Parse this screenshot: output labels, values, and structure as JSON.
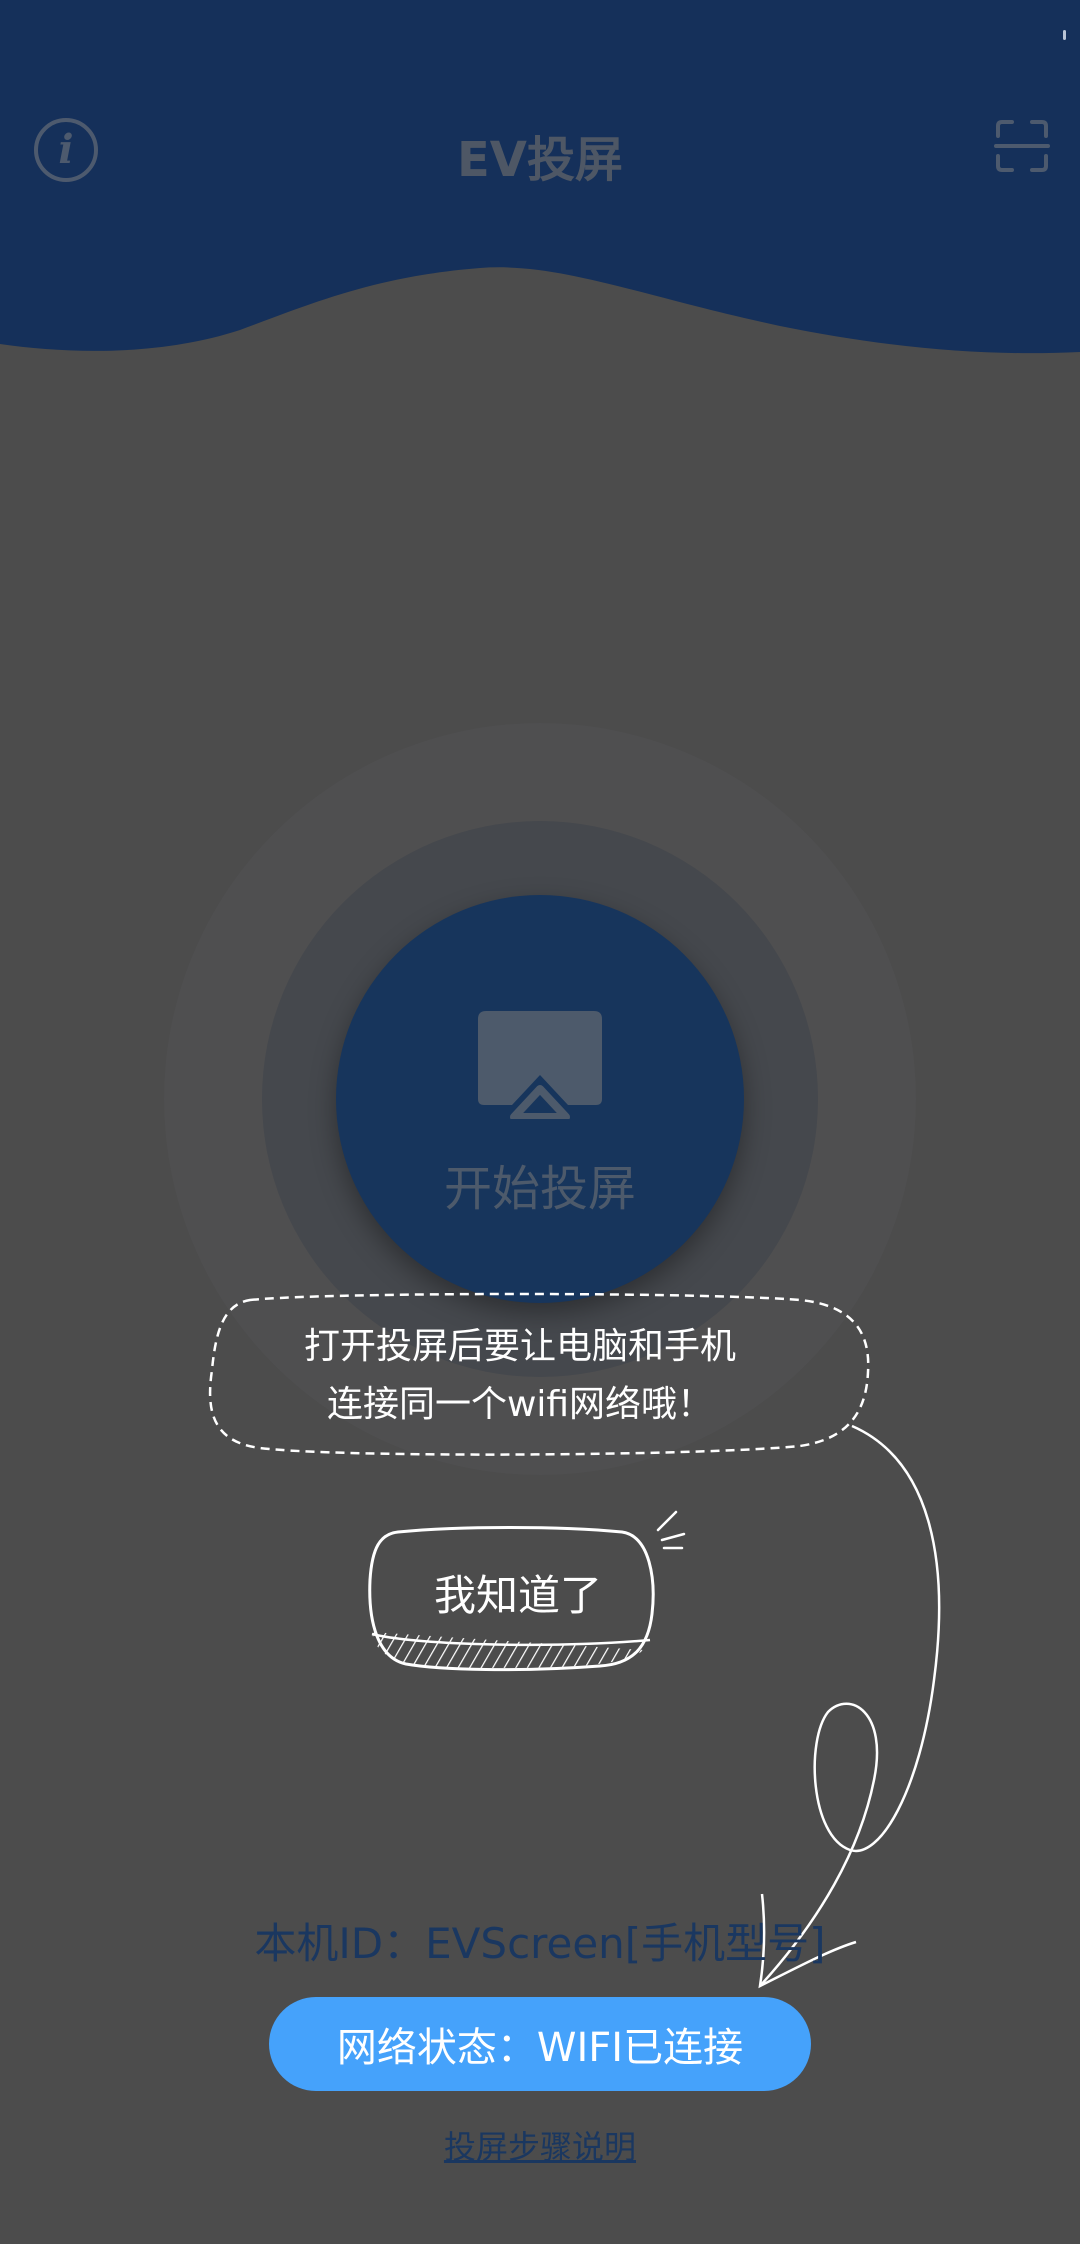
{
  "header": {
    "title": "EV投屏",
    "info_icon": "info-icon",
    "info_glyph": "i",
    "scan_icon": "scan-icon",
    "bg_color": "#15305a"
  },
  "main": {
    "start_label": "开始投屏",
    "start_icon": "screen-cast-icon",
    "button_color": "#17355c"
  },
  "tip": {
    "line1": "打开投屏后要让电脑和手机",
    "line2": "连接同一个wifi网络哦！",
    "confirm_label": "我知道了"
  },
  "footer": {
    "device_id": "本机ID：EVScreen[手机型号]",
    "network_status": "网络状态：WIFI已连接",
    "guide_link": "投屏步骤说明",
    "status_color": "#45a2fb"
  }
}
